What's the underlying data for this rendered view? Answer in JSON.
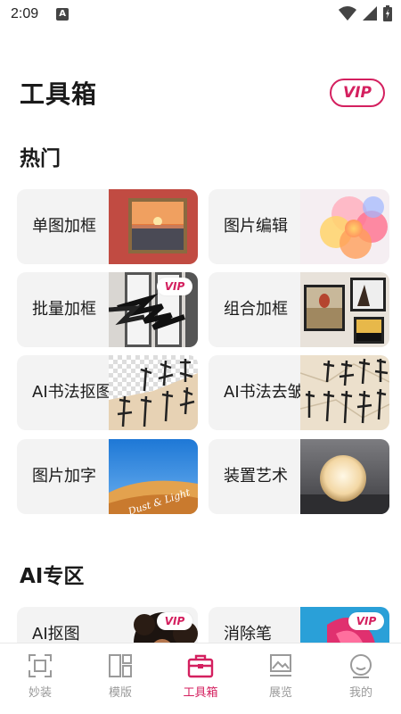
{
  "status": {
    "time": "2:09",
    "badge": "A"
  },
  "header": {
    "title": "工具箱",
    "vip": "VIP"
  },
  "sections": {
    "hot": "热门",
    "ai": "AI专区"
  },
  "tools": [
    {
      "label": "单图加框"
    },
    {
      "label": "图片编辑"
    },
    {
      "label": "批量加框",
      "vip": "VIP"
    },
    {
      "label": "组合加框"
    },
    {
      "label": "AI书法抠图"
    },
    {
      "label": "AI书法去皱"
    },
    {
      "label": "图片加字",
      "art_text": "Dust & Light"
    },
    {
      "label": "装置艺术"
    }
  ],
  "ai_tools": [
    {
      "label": "AI抠图",
      "vip": "VIP"
    },
    {
      "label": "消除笔",
      "vip": "VIP"
    }
  ],
  "nav": [
    {
      "label": "妙装"
    },
    {
      "label": "模版"
    },
    {
      "label": "工具箱",
      "active": true
    },
    {
      "label": "展览"
    },
    {
      "label": "我的"
    }
  ],
  "colors": {
    "accent": "#d4205f"
  }
}
